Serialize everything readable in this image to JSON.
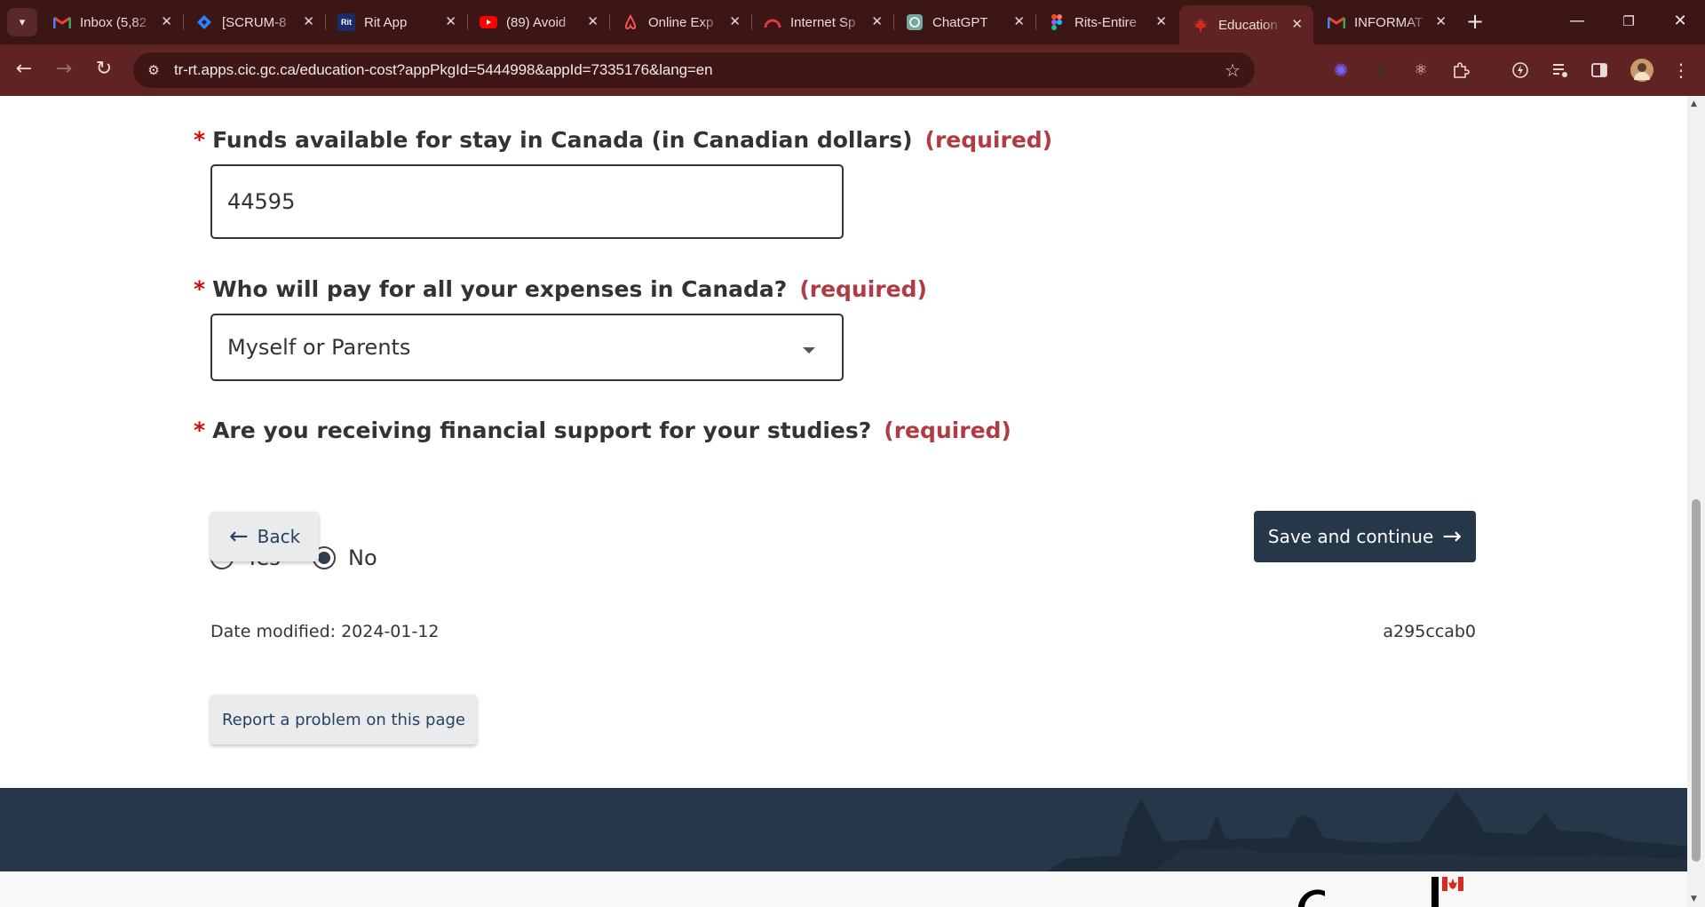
{
  "browser": {
    "tabs": [
      {
        "title": "Inbox (5,82",
        "icon": "gmail-icon"
      },
      {
        "title": "[SCRUM-8",
        "icon": "jira-icon"
      },
      {
        "title": "Rit App",
        "icon": "rit-icon"
      },
      {
        "title": "(89) Avoid",
        "icon": "youtube-icon"
      },
      {
        "title": "Online Exp",
        "icon": "airbnb-icon"
      },
      {
        "title": "Internet Sp",
        "icon": "speedtest-icon"
      },
      {
        "title": "ChatGPT",
        "icon": "chatgpt-icon"
      },
      {
        "title": "Rits-Entire",
        "icon": "figma-icon"
      },
      {
        "title": "Education",
        "icon": "maple-leaf-icon",
        "active": true
      },
      {
        "title": "INFORMAT",
        "icon": "gmail-icon"
      }
    ],
    "url": "tr-rt.apps.cic.gc.ca/education-cost?appPkgId=5444998&appId=7335176&lang=en",
    "rit_icon_text": "Rit"
  },
  "form": {
    "required_marker": "*",
    "required_text": "(required)",
    "funds": {
      "label": "Funds available for stay in Canada (in Canadian dollars)",
      "value": "44595"
    },
    "payer": {
      "label": "Who will pay for all your expenses in Canada?",
      "selected": "Myself or Parents"
    },
    "support": {
      "label": "Are you receiving financial support for your studies?",
      "options": [
        "Yes",
        "No"
      ],
      "selected": "No"
    }
  },
  "actions": {
    "back_label": "Back",
    "save_label": "Save and continue"
  },
  "footer": {
    "date_modified": "Date modified: 2024-01-12",
    "version": "a295ccab0",
    "report_label": "Report a problem on this page"
  },
  "colors": {
    "required_red": "#af3c43",
    "asterisk_red": "#d3080c",
    "primary_button": "#26374a",
    "footer_band": "#26374a",
    "chrome_dark": "#3c1515",
    "chrome_toolbar": "#5f2323"
  }
}
